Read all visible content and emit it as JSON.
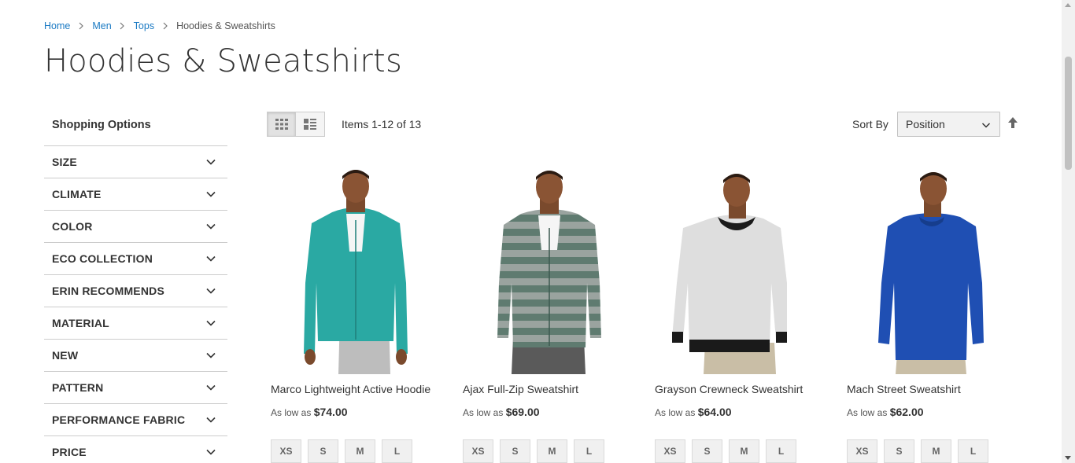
{
  "breadcrumbs": [
    {
      "label": "Home"
    },
    {
      "label": "Men"
    },
    {
      "label": "Tops"
    },
    {
      "label": "Hoodies & Sweatshirts"
    }
  ],
  "page_title": "Hoodies & Sweatshirts",
  "sidebar": {
    "title": "Shopping Options",
    "filters": [
      {
        "label": "SIZE"
      },
      {
        "label": "CLIMATE"
      },
      {
        "label": "COLOR"
      },
      {
        "label": "ECO COLLECTION"
      },
      {
        "label": "ERIN RECOMMENDS"
      },
      {
        "label": "MATERIAL"
      },
      {
        "label": "NEW"
      },
      {
        "label": "PATTERN"
      },
      {
        "label": "PERFORMANCE FABRIC"
      },
      {
        "label": "PRICE"
      }
    ]
  },
  "toolbar": {
    "amount": "Items 1-12 of 13",
    "sort_label": "Sort By",
    "sort_value": "Position",
    "view_modes": [
      "grid-icon",
      "list-icon"
    ]
  },
  "products": [
    {
      "name": "Marco Lightweight Active Hoodie",
      "price_prefix": "As low as",
      "price": "$74.00",
      "sizes": [
        "XS",
        "S",
        "M",
        "L"
      ],
      "color": "#2aa9a3"
    },
    {
      "name": "Ajax Full-Zip Sweatshirt",
      "price_prefix": "As low as",
      "price": "$69.00",
      "sizes": [
        "XS",
        "S",
        "M",
        "L"
      ],
      "color": "#7f8a86"
    },
    {
      "name": "Grayson Crewneck Sweatshirt",
      "price_prefix": "As low as",
      "price": "$64.00",
      "sizes": [
        "XS",
        "S",
        "M",
        "L"
      ],
      "color": "#dedede"
    },
    {
      "name": "Mach Street Sweatshirt",
      "price_prefix": "As low as",
      "price": "$62.00",
      "sizes": [
        "XS",
        "S",
        "M",
        "L"
      ],
      "color": "#1f4fb3"
    }
  ],
  "colors": {
    "link": "#1979c3",
    "text": "#333333",
    "border": "#cccccc"
  }
}
